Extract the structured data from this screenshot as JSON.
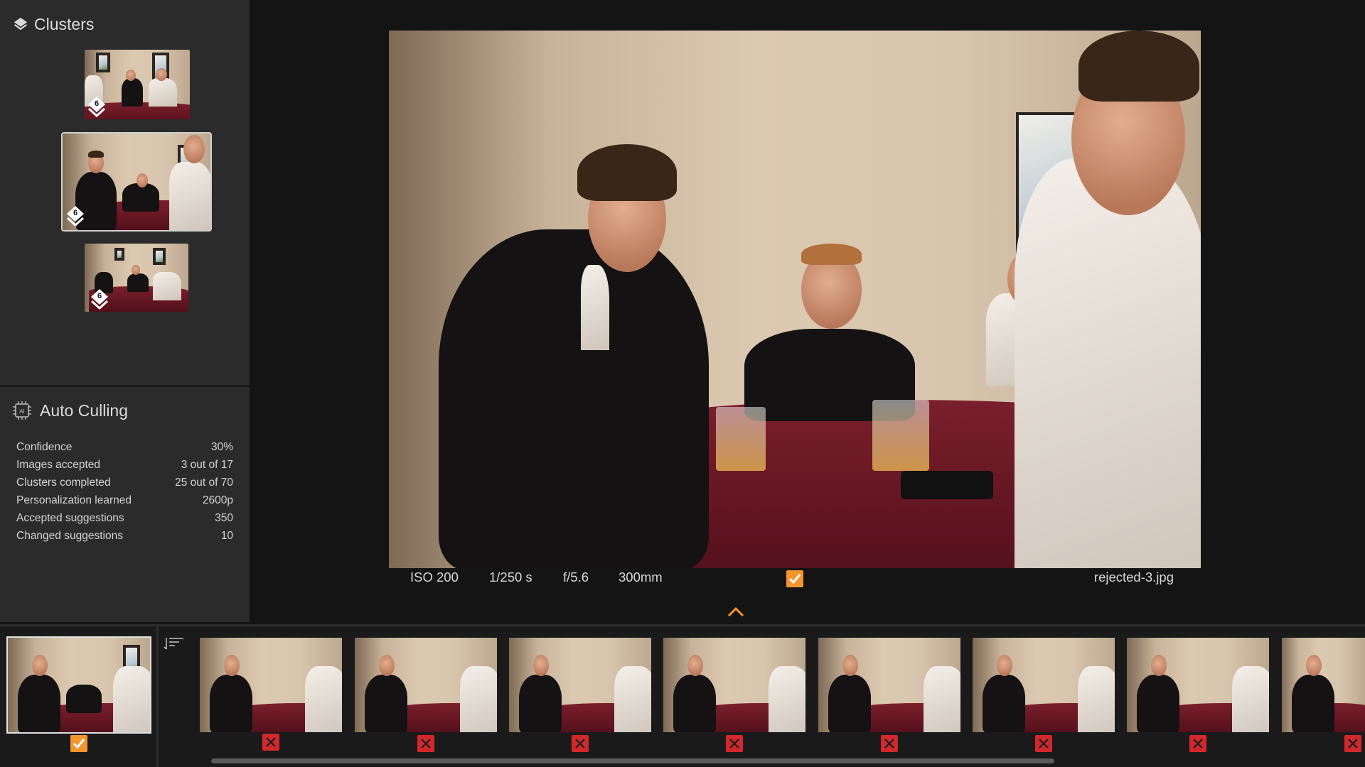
{
  "sidebar": {
    "clusters_title": "Clusters",
    "clusters": [
      {
        "count": "6",
        "selected": false
      },
      {
        "count": "6",
        "selected": true
      },
      {
        "count": "6",
        "selected": false
      }
    ],
    "auto_culling": {
      "title": "Auto Culling",
      "stats": [
        {
          "label": "Confidence",
          "value": "30%"
        },
        {
          "label": "Images accepted",
          "value": "3 out of 17"
        },
        {
          "label": "Clusters completed",
          "value": "25 out of 70"
        },
        {
          "label": "Personalization learned",
          "value": "2600p"
        },
        {
          "label": "Accepted suggestions",
          "value": "350"
        },
        {
          "label": "Changed suggestions",
          "value": "10"
        }
      ]
    }
  },
  "viewer": {
    "iso": "ISO 200",
    "shutter": "1/250 s",
    "aperture": "f/5.6",
    "focal_length": "300mm",
    "filename": "rejected-3.jpg",
    "status": "accepted"
  },
  "filmstrip": {
    "items": [
      {
        "status": "accepted",
        "current": true
      },
      {
        "status": "rejected"
      },
      {
        "status": "rejected"
      },
      {
        "status": "rejected"
      },
      {
        "status": "rejected"
      },
      {
        "status": "rejected"
      },
      {
        "status": "rejected"
      },
      {
        "status": "rejected"
      },
      {
        "status": "rejected"
      }
    ]
  },
  "colors": {
    "accent_accept": "#f3962d",
    "reject": "#d2282c",
    "panel": "#2b2b2b",
    "background": "#141414"
  }
}
